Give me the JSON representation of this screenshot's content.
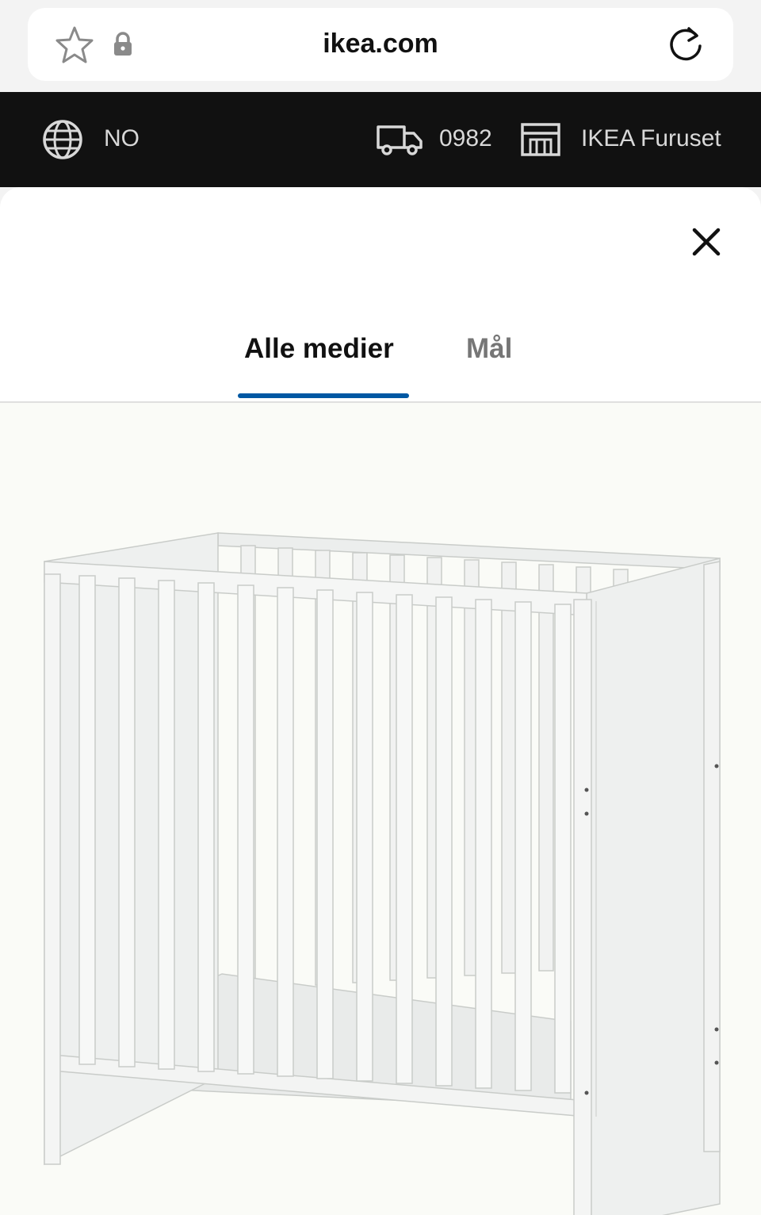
{
  "browser": {
    "url": "ikea.com",
    "icons": [
      "star-icon",
      "lock-icon",
      "reload-icon"
    ]
  },
  "header": {
    "language": "NO",
    "postcode": "0982",
    "store": "IKEA Furuset",
    "icons": [
      "globe-icon",
      "truck-icon",
      "store-icon"
    ]
  },
  "modal": {
    "tabs": [
      {
        "label": "Alle medier",
        "active": true
      },
      {
        "label": "Mål",
        "active": false
      }
    ],
    "accent": "#0058a3",
    "close_icon": "close-icon",
    "image": "product-image-crib"
  }
}
